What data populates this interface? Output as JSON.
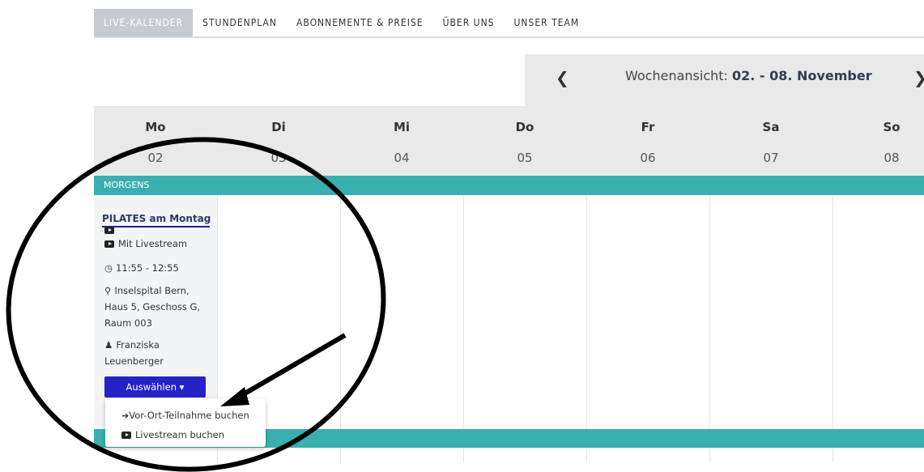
{
  "nav": {
    "items": [
      {
        "label": "LIVE-KALENDER",
        "active": true
      },
      {
        "label": "STUNDENPLAN"
      },
      {
        "label": "ABONNEMENTE & PREISE"
      },
      {
        "label": "ÜBER UNS"
      },
      {
        "label": "UNSER TEAM"
      }
    ]
  },
  "week": {
    "prefix": "Wochenansicht:",
    "range": "02. - 08. November",
    "prev_icon": "chevron-left-icon",
    "next_icon": "chevron-right-icon"
  },
  "days": [
    {
      "name": "Mo",
      "num": "02"
    },
    {
      "name": "Di",
      "num": "03"
    },
    {
      "name": "Mi",
      "num": "04"
    },
    {
      "name": "Do",
      "num": "05"
    },
    {
      "name": "Fr",
      "num": "06"
    },
    {
      "name": "Sa",
      "num": "07"
    },
    {
      "name": "So",
      "num": "08"
    }
  ],
  "section": {
    "label": "MORGENS"
  },
  "event": {
    "title": "PILATES am Montag",
    "livestream": "Mit Livestream",
    "time": "11:55 - 12:55",
    "location_1": "Inselspital Bern,",
    "location_2": "Haus 5, Geschoss G,",
    "location_3": "Raum 003",
    "instructor_1": "Franziska",
    "instructor_2": "Leuenberger",
    "select_button": "Auswählen"
  },
  "dropdown": {
    "items": [
      {
        "label": "Vor-Ort-Teilnahme buchen",
        "icon": "sign-in-icon"
      },
      {
        "label": "Livestream buchen",
        "icon": "youtube-icon"
      }
    ]
  },
  "colors": {
    "accent_teal": "#3aafaf",
    "button_blue": "#2323c8",
    "header_grey": "#e9e9ea"
  }
}
